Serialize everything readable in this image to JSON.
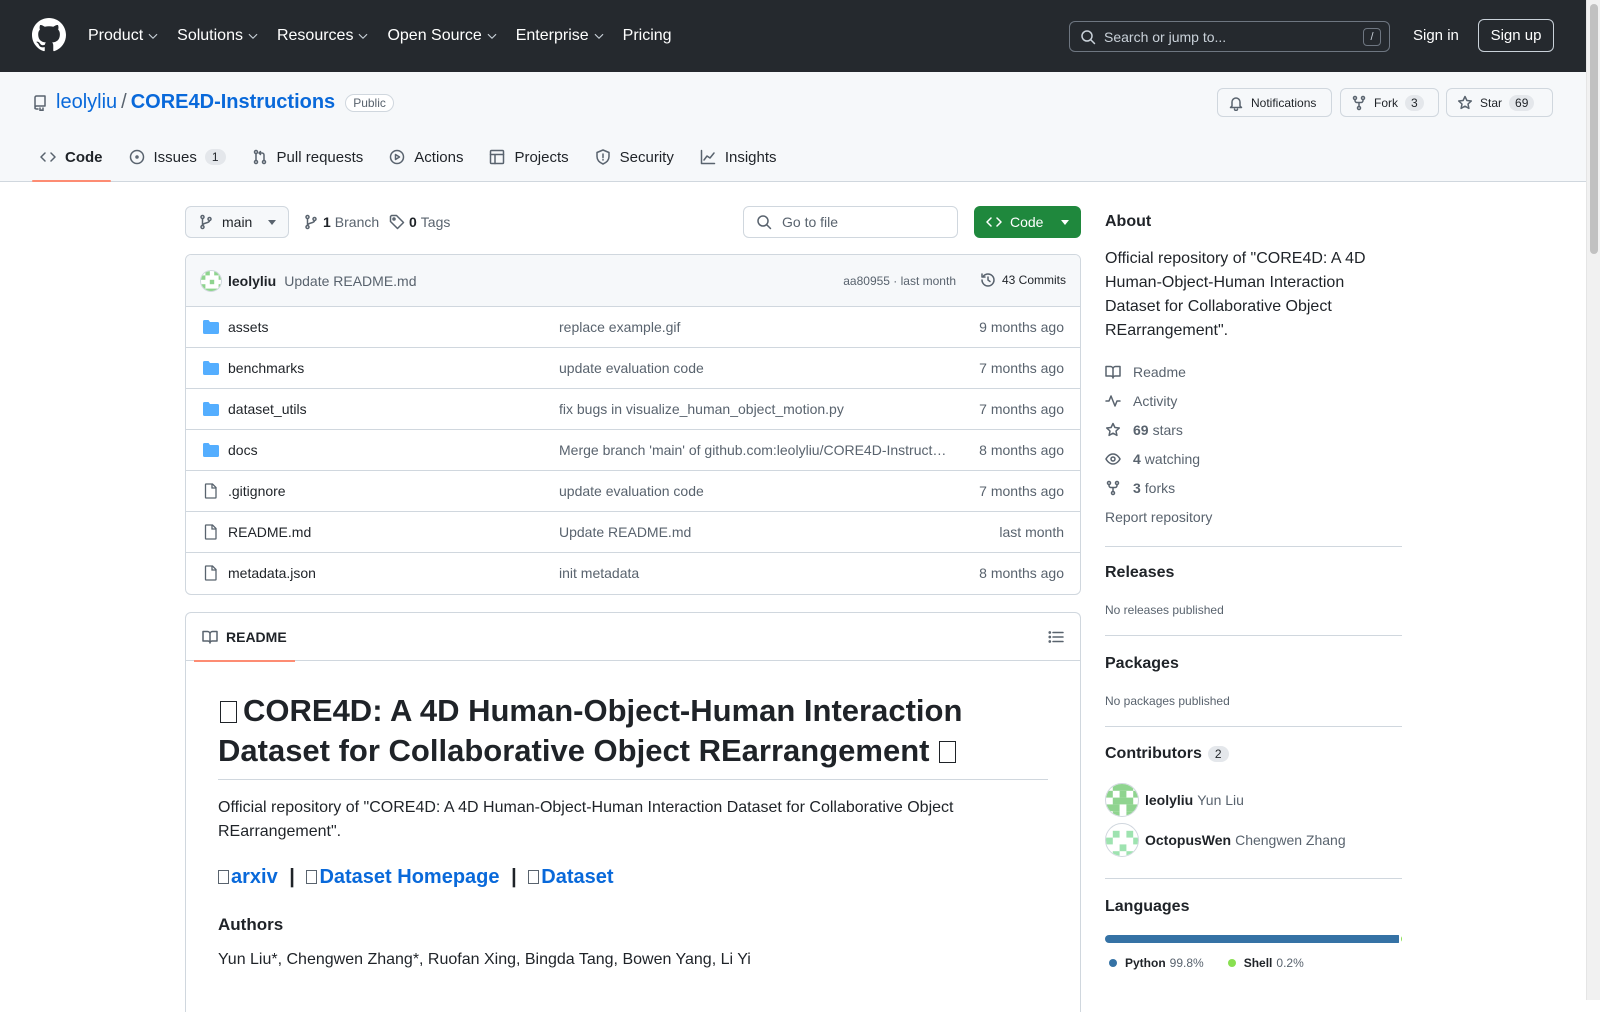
{
  "nav": {
    "items": [
      {
        "label": "Product",
        "dropdown": true
      },
      {
        "label": "Solutions",
        "dropdown": true
      },
      {
        "label": "Resources",
        "dropdown": true
      },
      {
        "label": "Open Source",
        "dropdown": true
      },
      {
        "label": "Enterprise",
        "dropdown": true
      },
      {
        "label": "Pricing",
        "dropdown": false
      }
    ],
    "search_placeholder": "Search or jump to...",
    "search_shortcut": "/",
    "signin": "Sign in",
    "signup": "Sign up"
  },
  "repo": {
    "owner": "leolyliu",
    "separator": "/",
    "name": "CORE4D-Instructions",
    "visibility": "Public",
    "notifications_label": "Notifications",
    "fork_label": "Fork",
    "fork_count": "3",
    "star_label": "Star",
    "star_count": "69"
  },
  "tabs": [
    {
      "label": "Code",
      "icon": "code-icon",
      "selected": true
    },
    {
      "label": "Issues",
      "icon": "issue-icon",
      "count": "1"
    },
    {
      "label": "Pull requests",
      "icon": "pull-request-icon"
    },
    {
      "label": "Actions",
      "icon": "play-icon"
    },
    {
      "label": "Projects",
      "icon": "table-icon"
    },
    {
      "label": "Security",
      "icon": "shield-icon"
    },
    {
      "label": "Insights",
      "icon": "graph-icon"
    }
  ],
  "toolbar": {
    "branch": "main",
    "branches_count": "1",
    "branches_label": "Branch",
    "tags_count": "0",
    "tags_label": "Tags",
    "gofile_placeholder": "Go to file",
    "code_button": "Code"
  },
  "latest_commit": {
    "author": "leolyliu",
    "message": "Update README.md",
    "hash_time": "aa80955 · last month",
    "commits_label": "43 Commits"
  },
  "files": [
    {
      "type": "folder",
      "name": "assets",
      "message": "replace example.gif",
      "date": "9 months ago"
    },
    {
      "type": "folder",
      "name": "benchmarks",
      "message": "update evaluation code",
      "date": "7 months ago"
    },
    {
      "type": "folder",
      "name": "dataset_utils",
      "message": "fix bugs in visualize_human_object_motion.py",
      "date": "7 months ago"
    },
    {
      "type": "folder",
      "name": "docs",
      "message": "Merge branch 'main' of github.com:leolyliu/CORE4D-Instructions",
      "date": "8 months ago"
    },
    {
      "type": "file",
      "name": ".gitignore",
      "message": "update evaluation code",
      "date": "7 months ago"
    },
    {
      "type": "file",
      "name": "README.md",
      "message": "Update README.md",
      "date": "last month"
    },
    {
      "type": "file",
      "name": "metadata.json",
      "message": "init metadata",
      "date": "8 months ago"
    }
  ],
  "readme": {
    "tab_label": "README",
    "title": "CORE4D: A 4D Human-Object-Human Interaction Dataset for Collaborative Object REarrangement",
    "description": "Official repository of \"CORE4D: A 4D Human-Object-Human Interaction Dataset for Collaborative Object REarrangement\".",
    "links": [
      "arxiv",
      "Dataset Homepage",
      "Dataset"
    ],
    "link_separator": "|",
    "authors_heading": "Authors",
    "authors": "Yun Liu*, Chengwen Zhang*, Ruofan Xing, Bingda Tang, Bowen Yang, Li Yi"
  },
  "sidebar": {
    "about_heading": "About",
    "about_description": "Official repository of \"CORE4D: A 4D Human-Object-Human Interaction Dataset for Collaborative Object REarrangement\".",
    "readme_link": "Readme",
    "activity_link": "Activity",
    "stars_count": "69",
    "stars_label": "stars",
    "watching_count": "4",
    "watching_label": "watching",
    "forks_count": "3",
    "forks_label": "forks",
    "report_link": "Report repository",
    "releases_heading": "Releases",
    "releases_text": "No releases published",
    "packages_heading": "Packages",
    "packages_text": "No packages published",
    "contributors_heading": "Contributors",
    "contributors_count": "2",
    "contributors": [
      {
        "login": "leolyliu",
        "name": "Yun Liu"
      },
      {
        "login": "OctopusWen",
        "name": "Chengwen Zhang"
      }
    ],
    "languages_heading": "Languages",
    "languages": [
      {
        "name": "Python",
        "percent": "99.8%",
        "value": 99.8,
        "color": "#3572A5"
      },
      {
        "name": "Shell",
        "percent": "0.2%",
        "value": 0.2,
        "color": "#89e051"
      }
    ]
  }
}
